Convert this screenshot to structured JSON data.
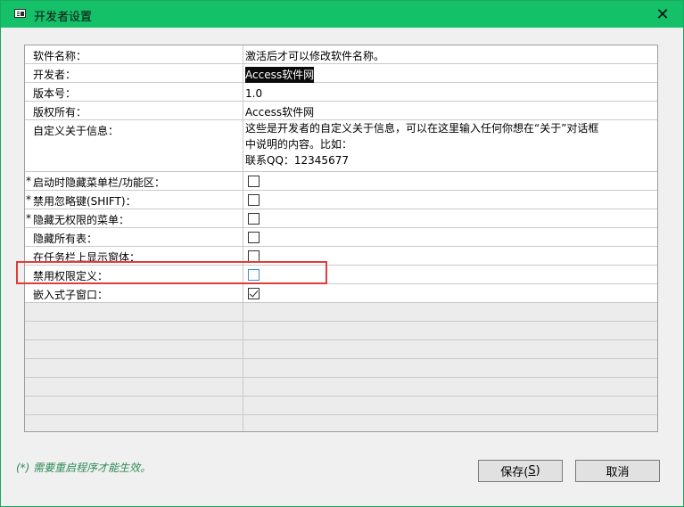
{
  "window": {
    "title": "开发者设置",
    "close_glyph": "✕"
  },
  "rows": [
    {
      "label": "软件名称：",
      "star": "",
      "value": "激活后才可以修改软件名称。"
    },
    {
      "label": "开发者：",
      "star": "",
      "value": "Access软件网"
    },
    {
      "label": "版本号：",
      "star": "",
      "value": "1.0"
    },
    {
      "label": "版权所有：",
      "star": "",
      "value": "Access软件网"
    },
    {
      "label": "自定义关于信息：",
      "star": "",
      "value_lines": [
        "这些是开发者的自定义关于信息，可以在这里输入任何你想在“关于”对话框",
        "中说明的内容。比如：",
        "联系QQ：12345677"
      ]
    },
    {
      "label": "启动时隐藏菜单栏/功能区：",
      "star": "*",
      "checked": false
    },
    {
      "label": "禁用忽略键(SHIFT)：",
      "star": "*",
      "checked": false
    },
    {
      "label": "隐藏无权限的菜单：",
      "star": "*",
      "checked": false
    },
    {
      "label": "隐藏所有表：",
      "star": "",
      "checked": false
    },
    {
      "label": "在任务栏上显示窗体：",
      "star": "",
      "checked": false
    },
    {
      "label": "禁用权限定义：",
      "star": "",
      "checked": false
    },
    {
      "label": "嵌入式子窗口：",
      "star": "",
      "checked": true
    }
  ],
  "footnote": "(*) 需要重启程序才能生效。",
  "buttons": {
    "save_label": "保存(",
    "save_key": "S",
    "save_suffix": ")",
    "cancel_label": "取消"
  }
}
